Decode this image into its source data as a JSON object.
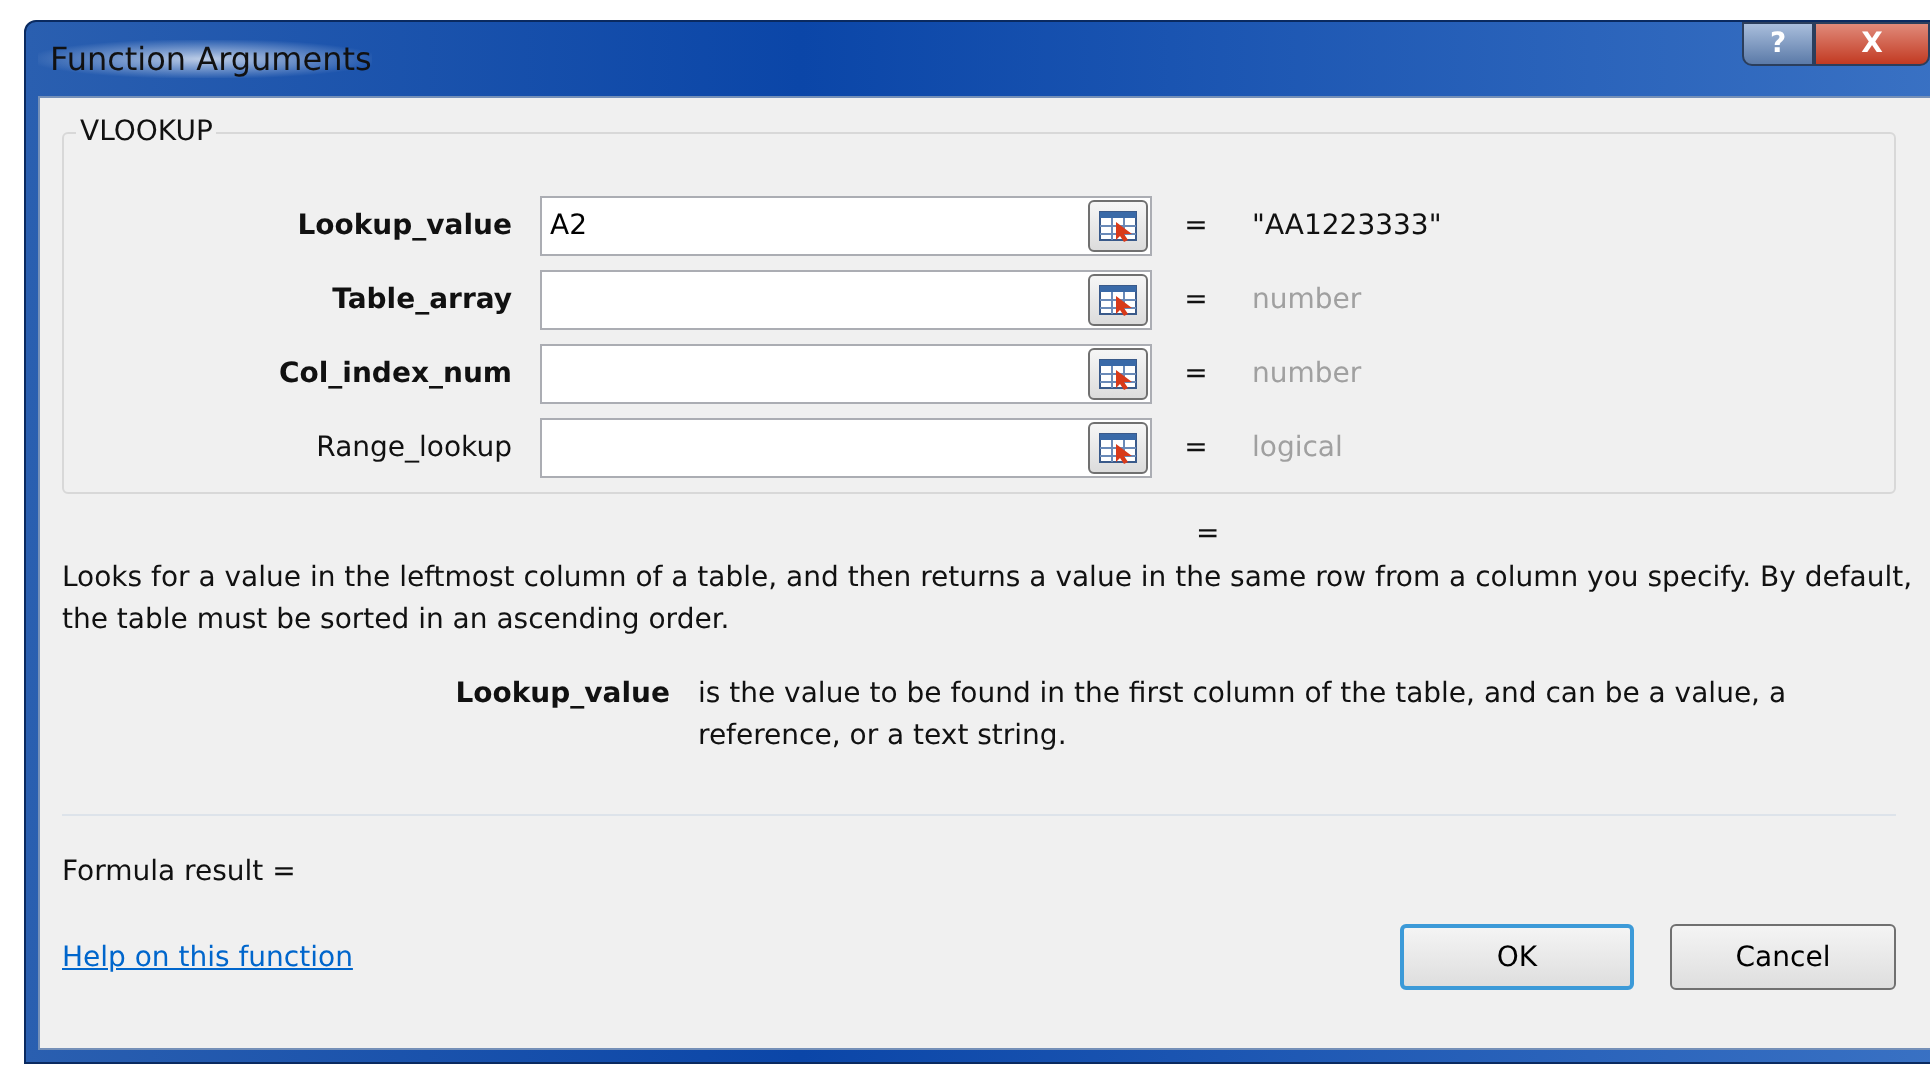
{
  "window": {
    "title": "Function Arguments",
    "buttons": [
      "?",
      "X"
    ]
  },
  "function_name": "VLOOKUP",
  "arguments": [
    {
      "label": "Lookup_value",
      "required": true,
      "value": "A2",
      "equals": "=",
      "result": "\"AA1223333\"",
      "greyed": false
    },
    {
      "label": "Table_array",
      "required": true,
      "equals": "=",
      "result": "number",
      "greyed": true
    },
    {
      "label": "Col_index_num",
      "required": true,
      "equals": "=",
      "result": "number",
      "greyed": true
    },
    {
      "label": "Range_lookup",
      "required": false,
      "equals": "=",
      "result": "logical",
      "greyed": true
    }
  ],
  "overall_equals": "=",
  "description": "Looks for a value in the leftmost column of a table, and then returns a value in the same row from a column you specify. By default, the table must be sorted in an ascending order.",
  "argument_help": {
    "name": "Lookup_value",
    "text": "is the value to be found in the first column of the table, and can be a value, a reference, or a text string."
  },
  "formula_result": "Formula result =",
  "help_link": "Help on this function",
  "buttons": [
    {
      "label": "OK",
      "default": true
    },
    {
      "label": "Cancel",
      "default": false
    }
  ]
}
